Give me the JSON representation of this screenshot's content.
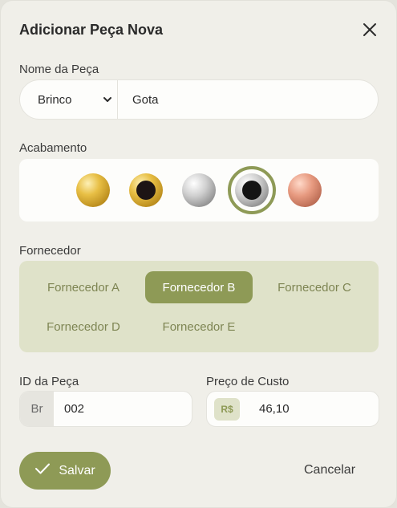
{
  "dialog": {
    "title": "Adicionar Peça Nova"
  },
  "piece_name": {
    "label": "Nome da Peça",
    "type_value": "Brinco",
    "name_value": "Gota"
  },
  "finish": {
    "label": "Acabamento",
    "swatches": [
      {
        "name": "gold",
        "color": "#e5b73b",
        "has_hole": false,
        "selected": false
      },
      {
        "name": "gold-with-hole",
        "color": "#e5b73b",
        "has_hole": true,
        "selected": false
      },
      {
        "name": "silver",
        "color": "#c8c8c8",
        "has_hole": false,
        "selected": false
      },
      {
        "name": "silver-with-hole",
        "color": "#c8c8c8",
        "has_hole": true,
        "selected": true
      },
      {
        "name": "rose-gold",
        "color": "#e79a80",
        "has_hole": false,
        "selected": false
      }
    ]
  },
  "supplier": {
    "label": "Fornecedor",
    "options": [
      {
        "label": "Fornecedor A",
        "selected": false
      },
      {
        "label": "Fornecedor B",
        "selected": true
      },
      {
        "label": "Fornecedor C",
        "selected": false
      },
      {
        "label": "Fornecedor D",
        "selected": false
      },
      {
        "label": "Fornecedor E",
        "selected": false
      }
    ]
  },
  "piece_id": {
    "label": "ID da Peça",
    "prefix": "Br",
    "value": "002"
  },
  "cost": {
    "label": "Preço de Custo",
    "currency": "R$",
    "value": "46,10"
  },
  "actions": {
    "save_label": "Salvar",
    "cancel_label": "Cancelar"
  },
  "colors": {
    "accent": "#8e9a56",
    "accent_light": "#dfe2c9",
    "background": "#f0efe9"
  }
}
